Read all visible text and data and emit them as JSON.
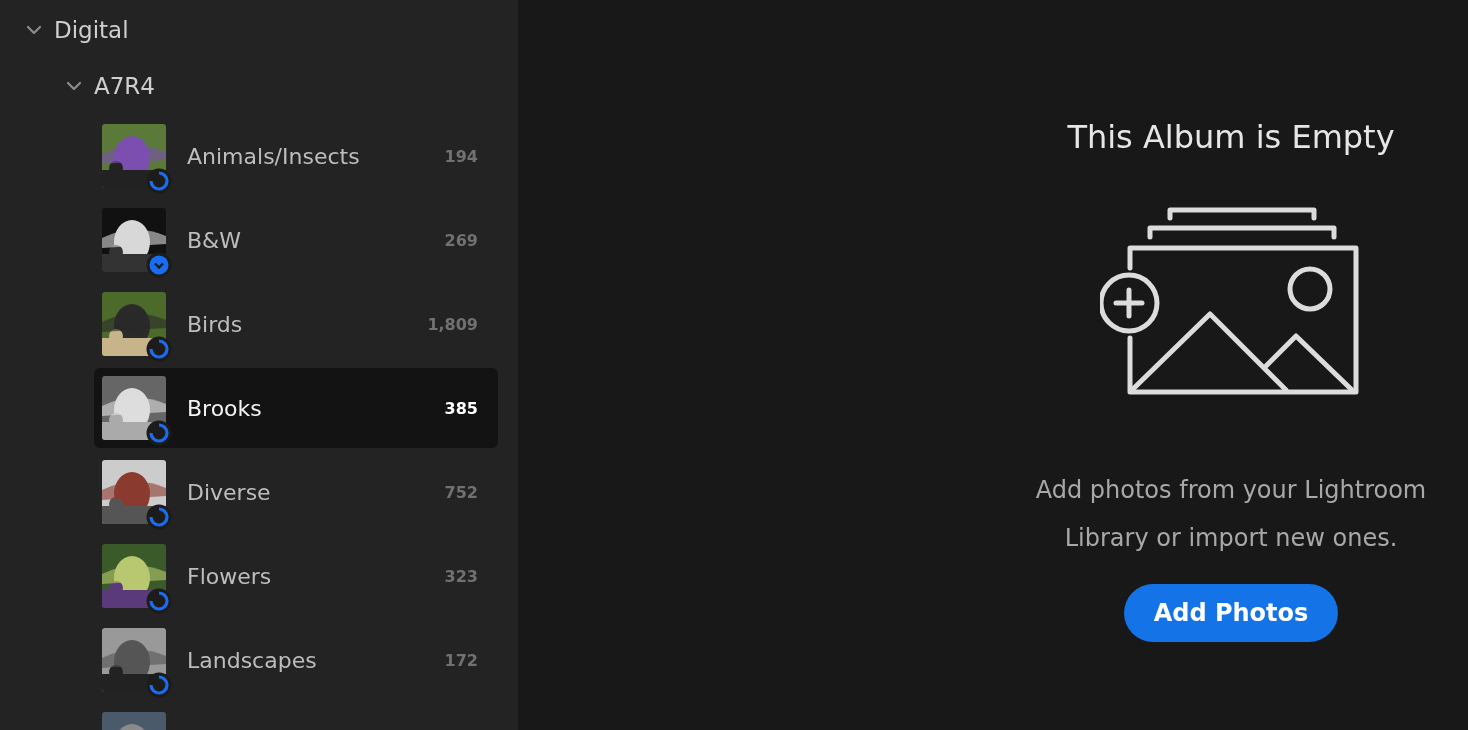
{
  "sidebar": {
    "tree": [
      {
        "label": "Digital",
        "expanded": true,
        "children": [
          {
            "label": "A7R4",
            "expanded": true,
            "albums": [
              {
                "kind": "syncing",
                "name": "Animals/Insects",
                "count": "194",
                "selected": false
              },
              {
                "kind": "downloaded",
                "name": "B&W",
                "count": "269",
                "selected": false
              },
              {
                "kind": "syncing",
                "name": "Birds",
                "count": "1,809",
                "selected": false
              },
              {
                "kind": "syncing",
                "name": "Brooks",
                "count": "385",
                "selected": true
              },
              {
                "kind": "syncing",
                "name": "Diverse",
                "count": "752",
                "selected": false
              },
              {
                "kind": "syncing",
                "name": "Flowers",
                "count": "323",
                "selected": false
              },
              {
                "kind": "syncing",
                "name": "Landscapes",
                "count": "172",
                "selected": false
              },
              {
                "kind": "cut-off",
                "selected": false
              }
            ]
          }
        ]
      }
    ]
  },
  "empty_state": {
    "title": "This Album is Empty",
    "message": "Add photos from your Lightroom Library or import new ones.",
    "button": "Add Photos"
  }
}
